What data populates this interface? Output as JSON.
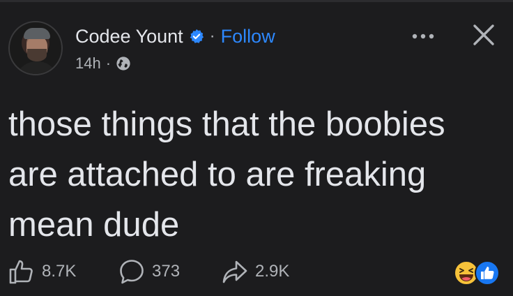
{
  "author": {
    "name": "Codee Yount",
    "verified_icon": "verified-badge-icon",
    "separator": "·",
    "follow_label": "Follow"
  },
  "meta": {
    "time": "14h",
    "separator": "·",
    "audience_icon": "globe-icon"
  },
  "post": {
    "text": "those things that the boobies are attached to are freaking mean dude"
  },
  "actions": {
    "likes": "8.7K",
    "comments": "373",
    "shares": "2.9K"
  },
  "reactions": [
    "haha",
    "like"
  ],
  "colors": {
    "background": "#1c1c1e",
    "text": "#e4e6eb",
    "secondary": "#b0b3b8",
    "accent": "#2d88ff"
  }
}
